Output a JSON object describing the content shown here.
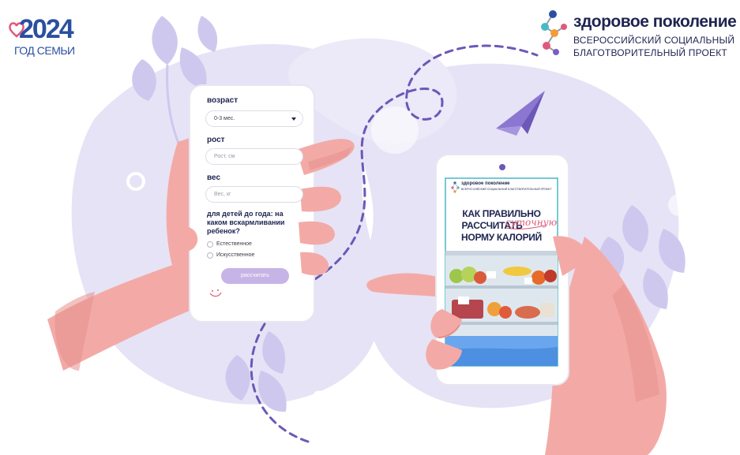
{
  "logos": {
    "year_logo": {
      "year": "2024",
      "subtitle": "ГОД СЕМЬИ"
    },
    "brand": {
      "name": "здоровое поколение",
      "tagline_line1": "ВСЕРОССИЙСКИЙ СОЦИАЛЬНЫЙ",
      "tagline_line2": "БЛАГОТВОРИТЕЛЬНЫЙ ПРОЕКТ"
    }
  },
  "calorie_form": {
    "age_label": "возраст",
    "age_selected": "0-3 мес.",
    "height_label": "рост",
    "height_placeholder": "Рост, см",
    "weight_label": "вес",
    "weight_placeholder": "Вес, кг",
    "feeding_question": "для детей до года: на каком вскармливании ребенок?",
    "feeding_options": [
      "Естественное",
      "Искусственное"
    ],
    "submit_label": "рассчитать"
  },
  "article_card": {
    "brand_name": "здоровое поколение",
    "brand_tag": "ВСЕРОССИЙСКИЙ СОЦИАЛЬНЫЙ БЛАГОТВОРИТЕЛЬНЫЙ ПРОЕКТ",
    "title_line1": "КАК ПРАВИЛЬНО",
    "title_line2": "РАССЧИТАТЬ",
    "title_accent": "суточную",
    "title_line3": "НОРМУ КАЛОРИЙ"
  },
  "colors": {
    "lavender_bg": "#e6e3f6",
    "lavender_leaf": "#cfc8ee",
    "hand": "#f3aaa6",
    "hand_shade": "#e58f8c",
    "navy": "#1e2450",
    "accent_pink": "#e05a7b",
    "button_violet": "#c7b4e6",
    "teal_border": "#49b8c6",
    "dash_violet": "#6d57b8"
  }
}
